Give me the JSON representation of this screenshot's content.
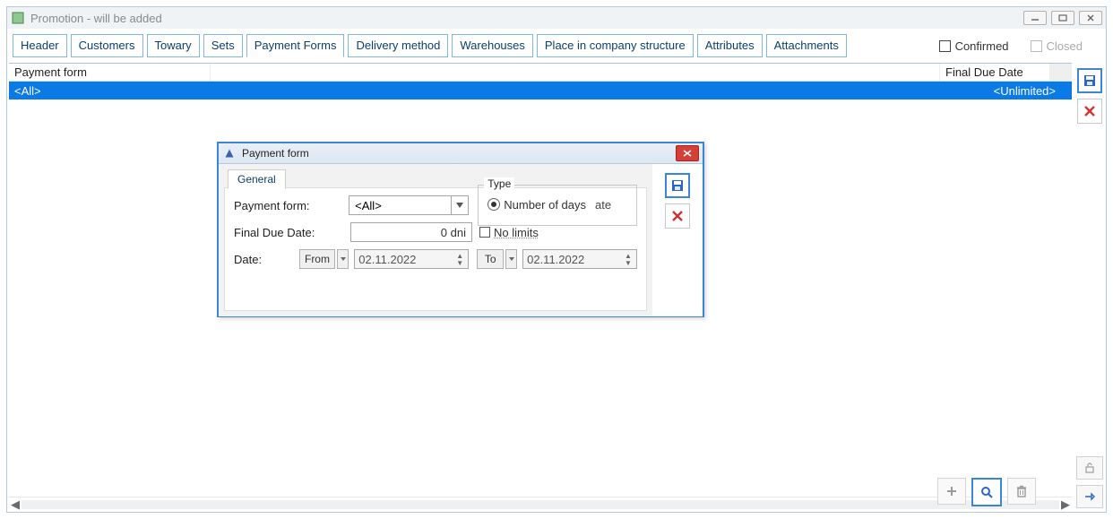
{
  "window": {
    "title": "Promotion - will be added"
  },
  "tabs": [
    {
      "label": "Header"
    },
    {
      "label": "Customers"
    },
    {
      "label": "Towary"
    },
    {
      "label": "Sets"
    },
    {
      "label": "Payment Forms",
      "active": true
    },
    {
      "label": "Delivery method"
    },
    {
      "label": "Warehouses"
    },
    {
      "label": "Place in company structure"
    },
    {
      "label": "Attributes"
    },
    {
      "label": "Attachments"
    }
  ],
  "topChecks": {
    "confirmed": "Confirmed",
    "closed": "Closed"
  },
  "grid": {
    "col1": "Payment form",
    "col2": "Final Due Date",
    "row": {
      "c1": "<All>",
      "c2": "<Unlimited>"
    }
  },
  "modal": {
    "title": "Payment form",
    "tab_general": "General",
    "label_payment_form": "Payment form:",
    "combo_value": "<All>",
    "type_legend": "Type",
    "radio_label": "Number of days",
    "radio_trail": "ate",
    "label_final_due": "Final Due Date:",
    "final_due_value": "0 dni",
    "no_limits": "No limits",
    "label_date": "Date:",
    "from": "From",
    "to": "To",
    "date_from": "02.11.2022",
    "date_to": "02.11.2022"
  }
}
